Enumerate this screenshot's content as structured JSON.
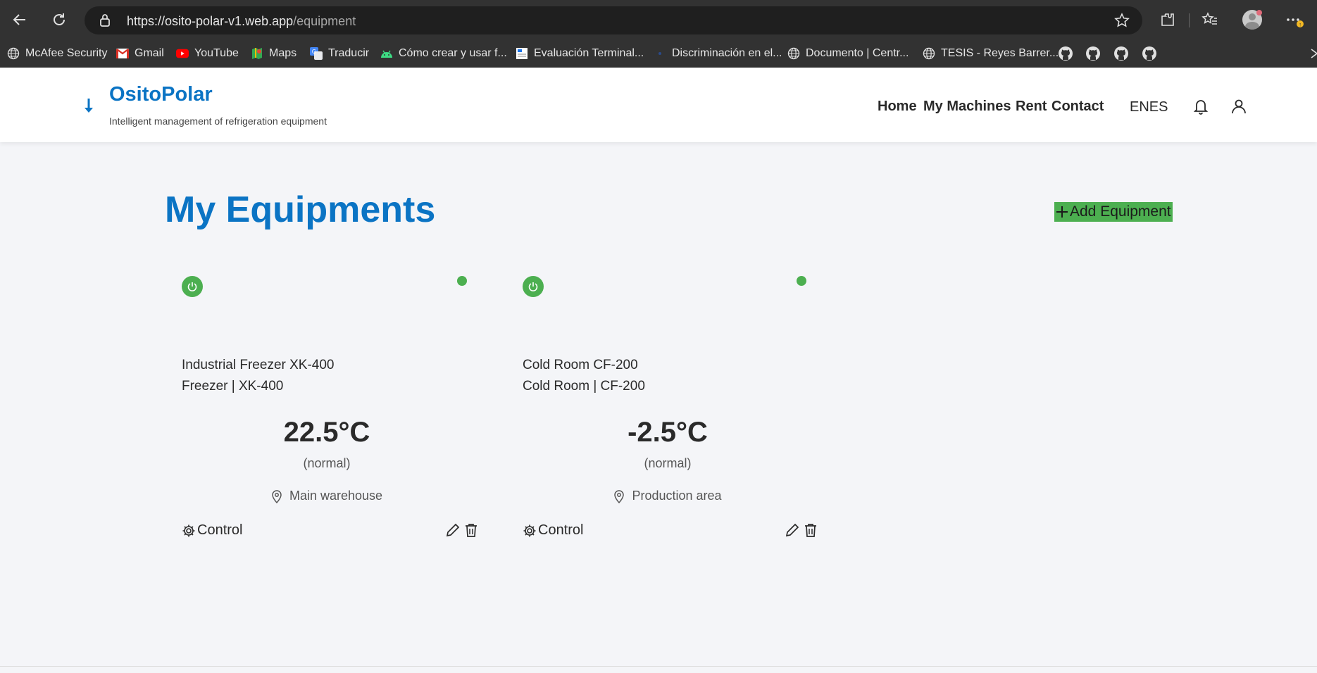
{
  "browser": {
    "url_host": "https://osito-polar-v1.web.app",
    "url_path": "/equipment",
    "bookmarks": [
      {
        "label": "McAfee Security",
        "icon": "globe-icon"
      },
      {
        "label": "Gmail",
        "icon": "gmail-icon"
      },
      {
        "label": "YouTube",
        "icon": "youtube-icon"
      },
      {
        "label": "Maps",
        "icon": "maps-icon"
      },
      {
        "label": "Traducir",
        "icon": "translate-icon"
      },
      {
        "label": "Cómo crear y usar f...",
        "icon": "android-icon"
      },
      {
        "label": "Evaluación Terminal...",
        "icon": "document-icon"
      },
      {
        "label": "Discriminación en el...",
        "icon": "dot-icon"
      },
      {
        "label": "Documento | Centr...",
        "icon": "globe-icon"
      },
      {
        "label": "TESIS - Reyes Barrer...",
        "icon": "globe-icon"
      }
    ]
  },
  "header": {
    "brand": "OsitoPolar",
    "tagline": "Intelligent management of refrigeration equipment",
    "nav": [
      "Home",
      "My Machines",
      "Rent",
      "Contact"
    ],
    "lang": "ENES"
  },
  "main": {
    "title": "My Equipments",
    "add_label": "Add Equipment",
    "control_label": "Control",
    "cards": [
      {
        "name": "Industrial Freezer XK-400",
        "type_model": "Freezer | XK-400",
        "temperature": "22.5°C",
        "temp_status": "(normal)",
        "location": "Main warehouse"
      },
      {
        "name": "Cold Room CF-200",
        "type_model": "Cold Room | CF-200",
        "temperature": "-2.5°C",
        "temp_status": "(normal)",
        "location": "Production area"
      }
    ]
  },
  "colors": {
    "brand": "#0b74c4",
    "accent_green": "#4caf50",
    "background": "#f4f5f8"
  }
}
